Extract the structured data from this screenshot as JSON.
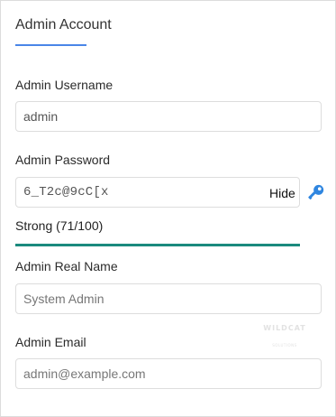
{
  "section": {
    "title": "Admin Account"
  },
  "username": {
    "label": "Admin Username",
    "value": "admin"
  },
  "password": {
    "label": "Admin Password",
    "value": "6_T2c@9cC[x",
    "toggle_label": "Hide",
    "generate_icon": "key-icon",
    "strength_text": "Strong (71/100)",
    "strength_score": 71,
    "strength_color": "#1b8a7e"
  },
  "realname": {
    "label": "Admin Real Name",
    "placeholder": "System Admin"
  },
  "email": {
    "label": "Admin Email",
    "placeholder": "admin@example.com"
  },
  "watermark": {
    "text": "WILDCAT",
    "subtext": "SOLUTIONS"
  },
  "colors": {
    "accent": "#4a86e8",
    "icon": "#2f86e0"
  }
}
